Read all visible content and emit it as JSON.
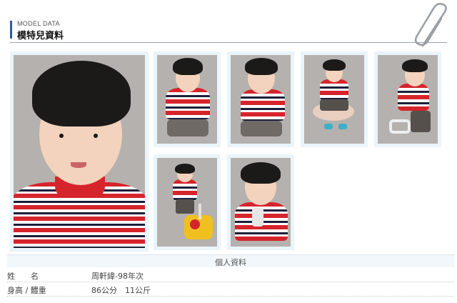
{
  "header": {
    "subtitle": "MODEL DATA",
    "title": "模特兒資料"
  },
  "section": {
    "title": "個人資料"
  },
  "info": [
    {
      "label": "姓　　名",
      "value": "周軒緯-98年次"
    },
    {
      "label": "身高 / 體重",
      "value": "86公分　11公斤"
    }
  ],
  "colors": {
    "accent": "#2f5d9e",
    "photo_frame": "#eaf4fb",
    "shirt_red": "#d6242c",
    "shirt_navy": "#1b1f3a"
  }
}
